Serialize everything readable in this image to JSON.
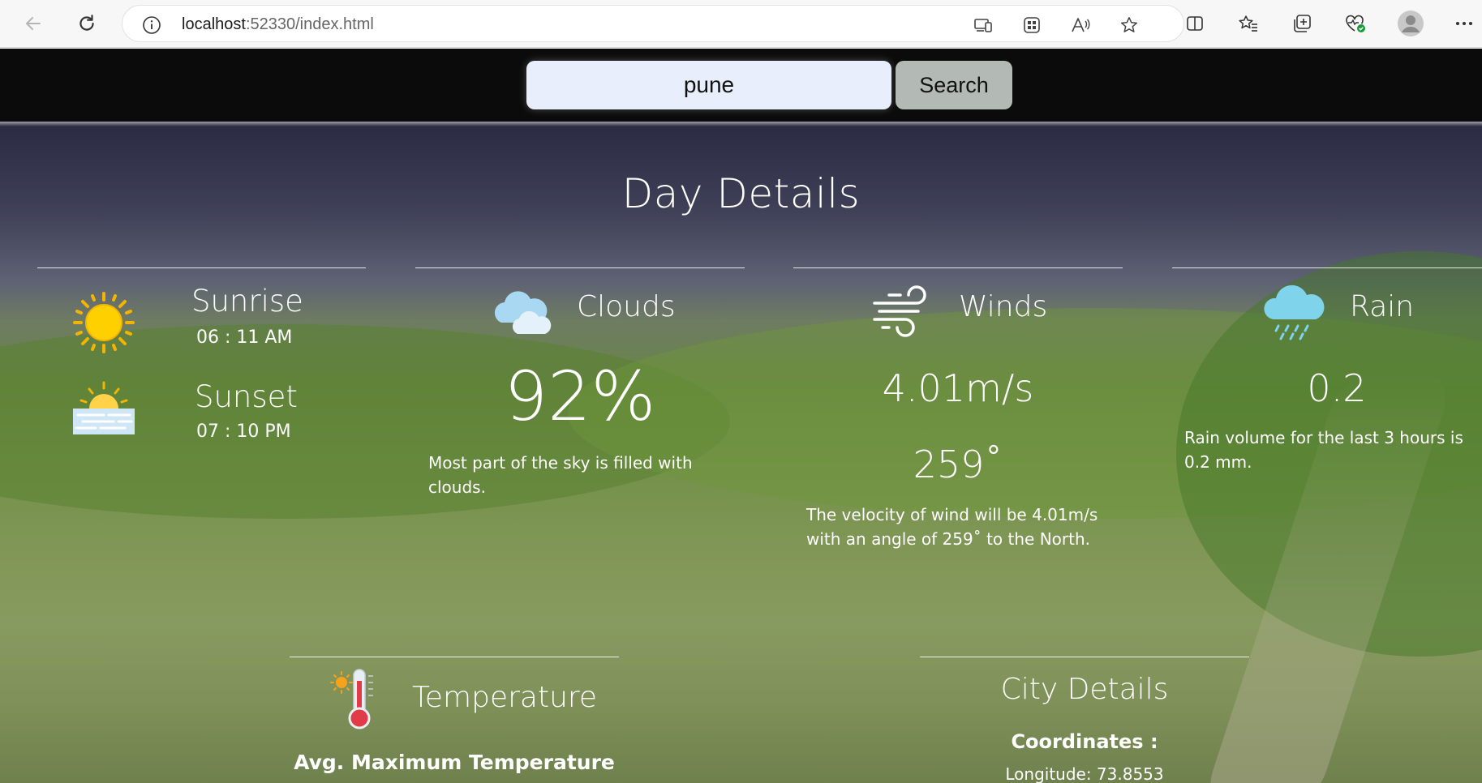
{
  "browser": {
    "url_host": "localhost",
    "url_rest": ":52330/index.html"
  },
  "search": {
    "value": "pune",
    "button_label": "Search"
  },
  "page_title": "Day Details",
  "sun": {
    "sunrise_label": "Sunrise",
    "sunrise_time": "06 : 11 AM",
    "sunset_label": "Sunset",
    "sunset_time": "07 : 10 PM"
  },
  "clouds": {
    "label": "Clouds",
    "value": "92%",
    "description": "Most part of the sky is filled with clouds."
  },
  "winds": {
    "label": "Winds",
    "speed": "4.01m/s",
    "angle": "259˚",
    "description": "The velocity of wind will be 4.01m/s with an angle of 259˚ to the North."
  },
  "rain": {
    "label": "Rain",
    "value": "0.2",
    "description": "Rain volume for the last 3 hours is 0.2 mm."
  },
  "temperature": {
    "label": "Temperature",
    "subheading": "Avg. Maximum Temperature"
  },
  "city": {
    "label": "City Details",
    "coordinates_label": "Coordinates :",
    "longitude": "Longitude: 73.8553"
  },
  "colors": {
    "topbar": "#0b0b0b",
    "search_input_bg": "#e8eefc",
    "search_button_bg": "#b3bab6",
    "text": "#ffffff"
  }
}
